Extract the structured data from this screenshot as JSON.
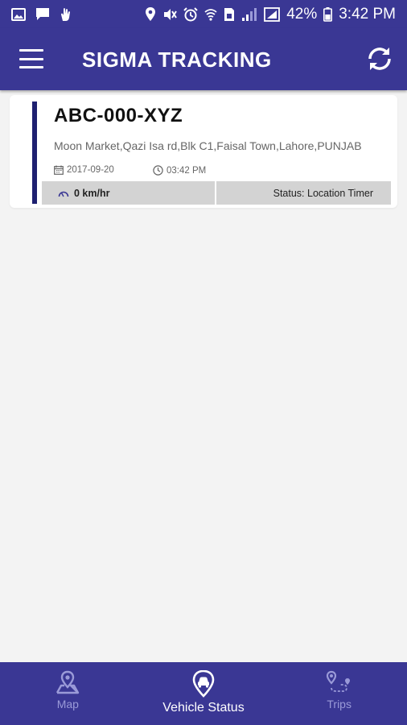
{
  "status_bar": {
    "battery": "42%",
    "time": "3:42 PM"
  },
  "app_bar": {
    "title": "SIGMA TRACKING"
  },
  "vehicles": [
    {
      "plate": "ABC-000-XYZ",
      "address": "Moon Market,Qazi Isa rd,Blk C1,Faisal Town,Lahore,PUNJAB",
      "date": "2017-09-20",
      "time": "03:42 PM",
      "speed": "0 km/hr",
      "status": "Status: Location Timer"
    }
  ],
  "bottom_nav": {
    "items": [
      {
        "label": "Map",
        "icon": "map-pin-icon",
        "active": false
      },
      {
        "label": "Vehicle Status",
        "icon": "car-pin-icon",
        "active": true
      },
      {
        "label": "Trips",
        "icon": "route-icon",
        "active": false
      }
    ]
  },
  "colors": {
    "primary": "#3a3794",
    "accent": "#1e2070",
    "nav_inactive": "#9a9ad8"
  }
}
